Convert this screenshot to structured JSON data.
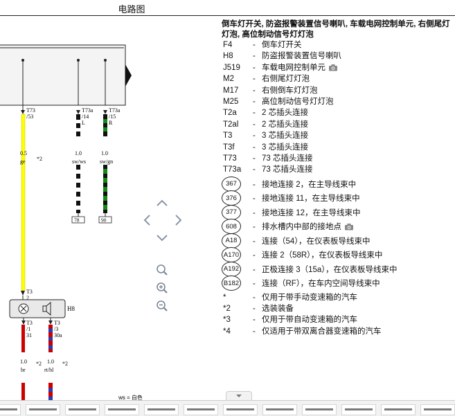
{
  "header": {
    "title": "电路图"
  },
  "diagram": {
    "wires": [
      {
        "conn": "T73",
        "pin": "/53",
        "size": "0.5",
        "color_code": "ge",
        "note": "*2"
      },
      {
        "conn": "T73a",
        "pin": "/14",
        "pin_sub": "L",
        "size": "1.0",
        "color_code": "sw/ws",
        "ref": "78"
      },
      {
        "conn": "T73a",
        "pin": "/15",
        "pin_sub": "R",
        "size": "1.0",
        "color_code": "sw/gn",
        "ref": "90"
      }
    ],
    "lower_wires": [
      {
        "conn": "T3",
        "pin": "/1",
        "num": "31",
        "size": "1.0",
        "color_code": "br",
        "note": "*2"
      },
      {
        "conn": "T3",
        "pin": "/3",
        "num": "30a",
        "size": "1.0",
        "color_code": "rt/bl",
        "note": "*2"
      }
    ],
    "horn_connector": {
      "conn": "T3",
      "pin": "2"
    },
    "component_label": "H8",
    "footnote": "ws = 白色",
    "colors": {
      "yellow": "#ffff00",
      "red": "#cc0000",
      "blue": "#1f3fbf",
      "green": "#138a13",
      "black": "#111111",
      "white": "#ffffff"
    }
  },
  "nav": {
    "icons": [
      "chevron-up-icon",
      "chevron-left-icon",
      "chevron-right-icon",
      "chevron-down-icon",
      "zoom-fit-icon",
      "zoom-in-icon",
      "zoom-out-icon"
    ]
  },
  "legend": {
    "title": "倒车灯开关, 防盗报警装置信号喇叭, 车载电网控制单元, 右侧尾灯灯泡, 高位制动信号灯灯泡",
    "entries": [
      {
        "code": "F4",
        "desc": "倒车灯开关"
      },
      {
        "code": "H8",
        "desc": "防盗报警装置信号喇叭"
      },
      {
        "code": "J519",
        "desc": "车载电网控制单元",
        "camera": true
      },
      {
        "code": "M2",
        "desc": "右侧尾灯灯泡"
      },
      {
        "code": "M17",
        "desc": "右侧倒车灯灯泡"
      },
      {
        "code": "M25",
        "desc": "高位制动信号灯灯泡"
      },
      {
        "code": "T2a",
        "desc": "2 芯插头连接"
      },
      {
        "code": "T2al",
        "desc": "2 芯插头连接"
      },
      {
        "code": "T3",
        "desc": "3 芯插头连接"
      },
      {
        "code": "T3f",
        "desc": "3 芯插头连接"
      },
      {
        "code": "T73",
        "desc": "73 芯插头连接"
      },
      {
        "code": "T73a",
        "desc": "73 芯插头连接"
      }
    ],
    "circle_entries": [
      {
        "code": "367",
        "desc": "接地连接 2，在主导线束中"
      },
      {
        "code": "376",
        "desc": "接地连接 11，在主导线束中"
      },
      {
        "code": "377",
        "desc": "接地连接 12，在主导线束中"
      },
      {
        "code": "608",
        "desc": "排水槽内中部的接地点",
        "camera": true
      },
      {
        "code": "A18",
        "desc": "连接（54），在仪表板导线束中"
      },
      {
        "code": "A170",
        "desc": "连接 2（58R），在仪表板导线束中"
      },
      {
        "code": "A192",
        "desc": "正极连接 3（15a），在仪表板导线束中"
      },
      {
        "code": "B182",
        "desc": "连接（RF），在车内空间导线束中"
      }
    ],
    "notes": [
      {
        "code": "*",
        "desc": "仅用于带手动变速箱的汽车"
      },
      {
        "code": "*2",
        "desc": "选装装备"
      },
      {
        "code": "*3",
        "desc": "仅用于带自动变速箱的汽车"
      },
      {
        "code": "*4",
        "desc": "仅适用于带双离合器变速箱的汽车"
      }
    ]
  },
  "thumbnails": {
    "count": 12
  }
}
